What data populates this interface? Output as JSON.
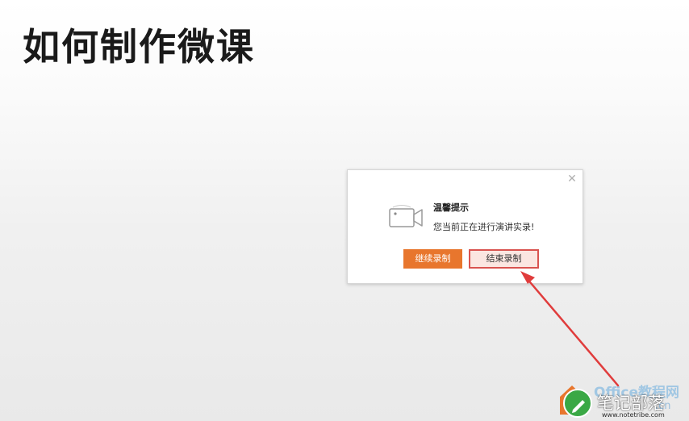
{
  "slide": {
    "title": "如何制作微课"
  },
  "dialog": {
    "close_symbol": "✕",
    "icon": "video-camera-icon",
    "title": "温馨提示",
    "message": "您当前正在进行演讲实录!",
    "continue_label": "继续录制",
    "end_label": "结束录制"
  },
  "watermark": {
    "office_text": "Office教程网",
    "brand_text": "笔记部落",
    "cn_text": ".cn",
    "url_text": "www.notetribe.com"
  },
  "colors": {
    "accent_orange": "#e8762d",
    "highlight_red": "#d9534f",
    "arrow_red": "#e03c3c",
    "watermark_green": "#3aa845"
  }
}
